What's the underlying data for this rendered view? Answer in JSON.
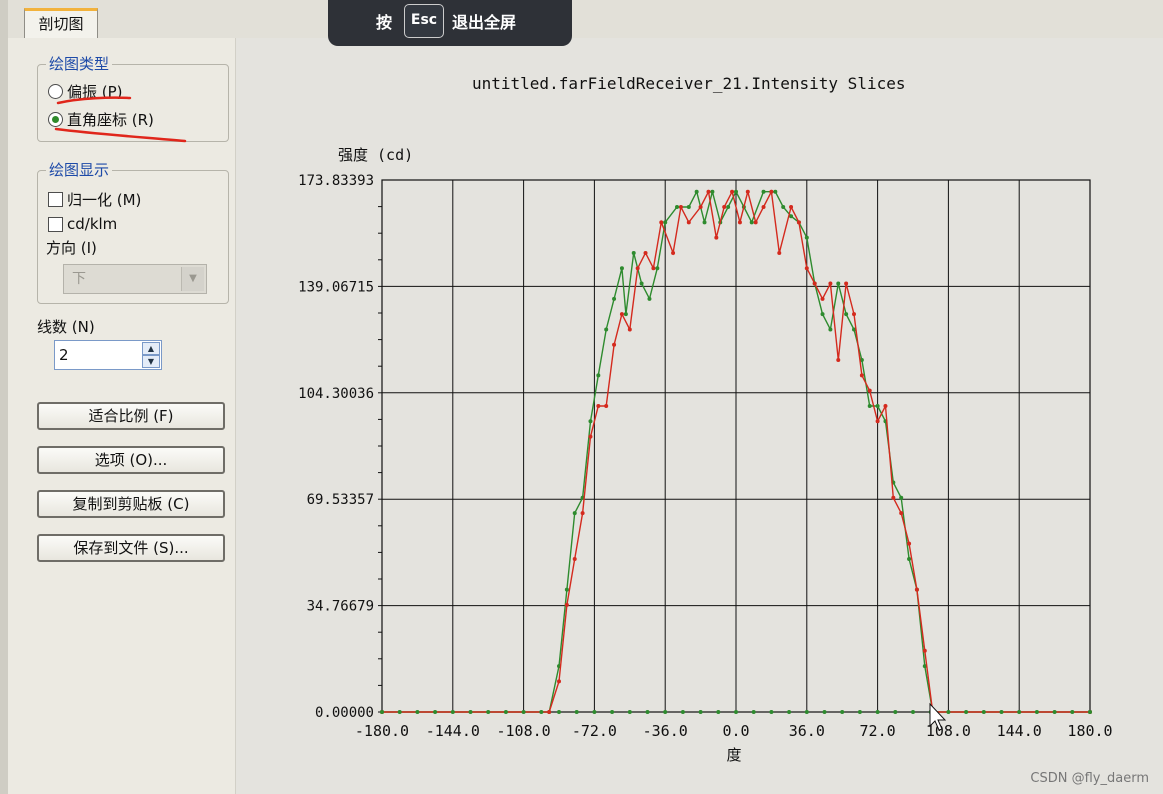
{
  "tab": {
    "label": "剖切图"
  },
  "overlay": {
    "pre": "按",
    "key": "Esc",
    "post": "退出全屏"
  },
  "plot_type_group": {
    "title": "绘图类型",
    "options": [
      {
        "label": "偏振 (P)",
        "selected": false
      },
      {
        "label": "直角座标 (R)",
        "selected": true
      }
    ]
  },
  "display_group": {
    "title": "绘图显示",
    "normalize": {
      "label": "归一化 (M)",
      "checked": false
    },
    "cdklm": {
      "label": "cd/klm",
      "checked": false
    },
    "direction_label": "方向 (I)",
    "direction_value": "下"
  },
  "lines": {
    "label": "线数 (N)",
    "value": "2"
  },
  "buttons": {
    "fit": "适合比例 (F)",
    "options": "选项 (O)...",
    "copy": "复制到剪贴板 (C)",
    "save": "保存到文件 (S)..."
  },
  "watermark": "CSDN @fly_daerm",
  "chart_data": {
    "type": "line",
    "title": "untitled.farFieldReceiver_21.Intensity Slices",
    "xlabel": "度",
    "ylabel": "强度 (cd)",
    "xlim": [
      -180,
      180
    ],
    "ylim": [
      0,
      173.83393
    ],
    "x_ticks": [
      "-180.0",
      "-144.0",
      "-108.0",
      "-72.0",
      "-36.0",
      "0.0",
      "36.0",
      "72.0",
      "108.0",
      "144.0",
      "180.0"
    ],
    "y_ticks": [
      "0.00000",
      "34.76679",
      "69.53357",
      "104.30036",
      "139.06715",
      "173.83393"
    ],
    "grid": true,
    "series": [
      {
        "color": "#2e8b2e",
        "points": [
          [
            -180,
            0
          ],
          [
            -95,
            0
          ],
          [
            -90,
            15
          ],
          [
            -86,
            40
          ],
          [
            -82,
            65
          ],
          [
            -78,
            70
          ],
          [
            -74,
            95
          ],
          [
            -70,
            110
          ],
          [
            -66,
            125
          ],
          [
            -62,
            135
          ],
          [
            -58,
            145
          ],
          [
            -56,
            130
          ],
          [
            -52,
            150
          ],
          [
            -48,
            140
          ],
          [
            -44,
            135
          ],
          [
            -40,
            145
          ],
          [
            -36,
            160
          ],
          [
            -30,
            165
          ],
          [
            -24,
            165
          ],
          [
            -20,
            170
          ],
          [
            -16,
            160
          ],
          [
            -12,
            170
          ],
          [
            -8,
            160
          ],
          [
            -4,
            165
          ],
          [
            0,
            170
          ],
          [
            4,
            165
          ],
          [
            8,
            160
          ],
          [
            14,
            170
          ],
          [
            20,
            170
          ],
          [
            24,
            165
          ],
          [
            28,
            162
          ],
          [
            32,
            160
          ],
          [
            36,
            155
          ],
          [
            40,
            140
          ],
          [
            44,
            130
          ],
          [
            48,
            125
          ],
          [
            52,
            140
          ],
          [
            56,
            130
          ],
          [
            60,
            125
          ],
          [
            64,
            115
          ],
          [
            68,
            100
          ],
          [
            72,
            100
          ],
          [
            76,
            95
          ],
          [
            80,
            75
          ],
          [
            84,
            70
          ],
          [
            88,
            50
          ],
          [
            92,
            40
          ],
          [
            96,
            15
          ],
          [
            100,
            0
          ],
          [
            180,
            0
          ]
        ]
      },
      {
        "color": "#d42a1e",
        "points": [
          [
            -180,
            0
          ],
          [
            -95,
            0
          ],
          [
            -90,
            10
          ],
          [
            -86,
            35
          ],
          [
            -82,
            50
          ],
          [
            -78,
            65
          ],
          [
            -74,
            90
          ],
          [
            -70,
            100
          ],
          [
            -66,
            100
          ],
          [
            -62,
            120
          ],
          [
            -58,
            130
          ],
          [
            -54,
            125
          ],
          [
            -50,
            145
          ],
          [
            -46,
            150
          ],
          [
            -42,
            145
          ],
          [
            -38,
            160
          ],
          [
            -32,
            150
          ],
          [
            -28,
            165
          ],
          [
            -24,
            160
          ],
          [
            -18,
            165
          ],
          [
            -14,
            170
          ],
          [
            -10,
            155
          ],
          [
            -6,
            165
          ],
          [
            -2,
            170
          ],
          [
            2,
            160
          ],
          [
            6,
            170
          ],
          [
            10,
            160
          ],
          [
            14,
            165
          ],
          [
            18,
            170
          ],
          [
            22,
            150
          ],
          [
            28,
            165
          ],
          [
            32,
            160
          ],
          [
            36,
            145
          ],
          [
            40,
            140
          ],
          [
            44,
            135
          ],
          [
            48,
            140
          ],
          [
            52,
            115
          ],
          [
            56,
            140
          ],
          [
            60,
            130
          ],
          [
            64,
            110
          ],
          [
            68,
            105
          ],
          [
            72,
            95
          ],
          [
            76,
            100
          ],
          [
            80,
            70
          ],
          [
            84,
            65
          ],
          [
            88,
            55
          ],
          [
            92,
            40
          ],
          [
            96,
            20
          ],
          [
            100,
            0
          ],
          [
            180,
            0
          ]
        ]
      }
    ]
  }
}
